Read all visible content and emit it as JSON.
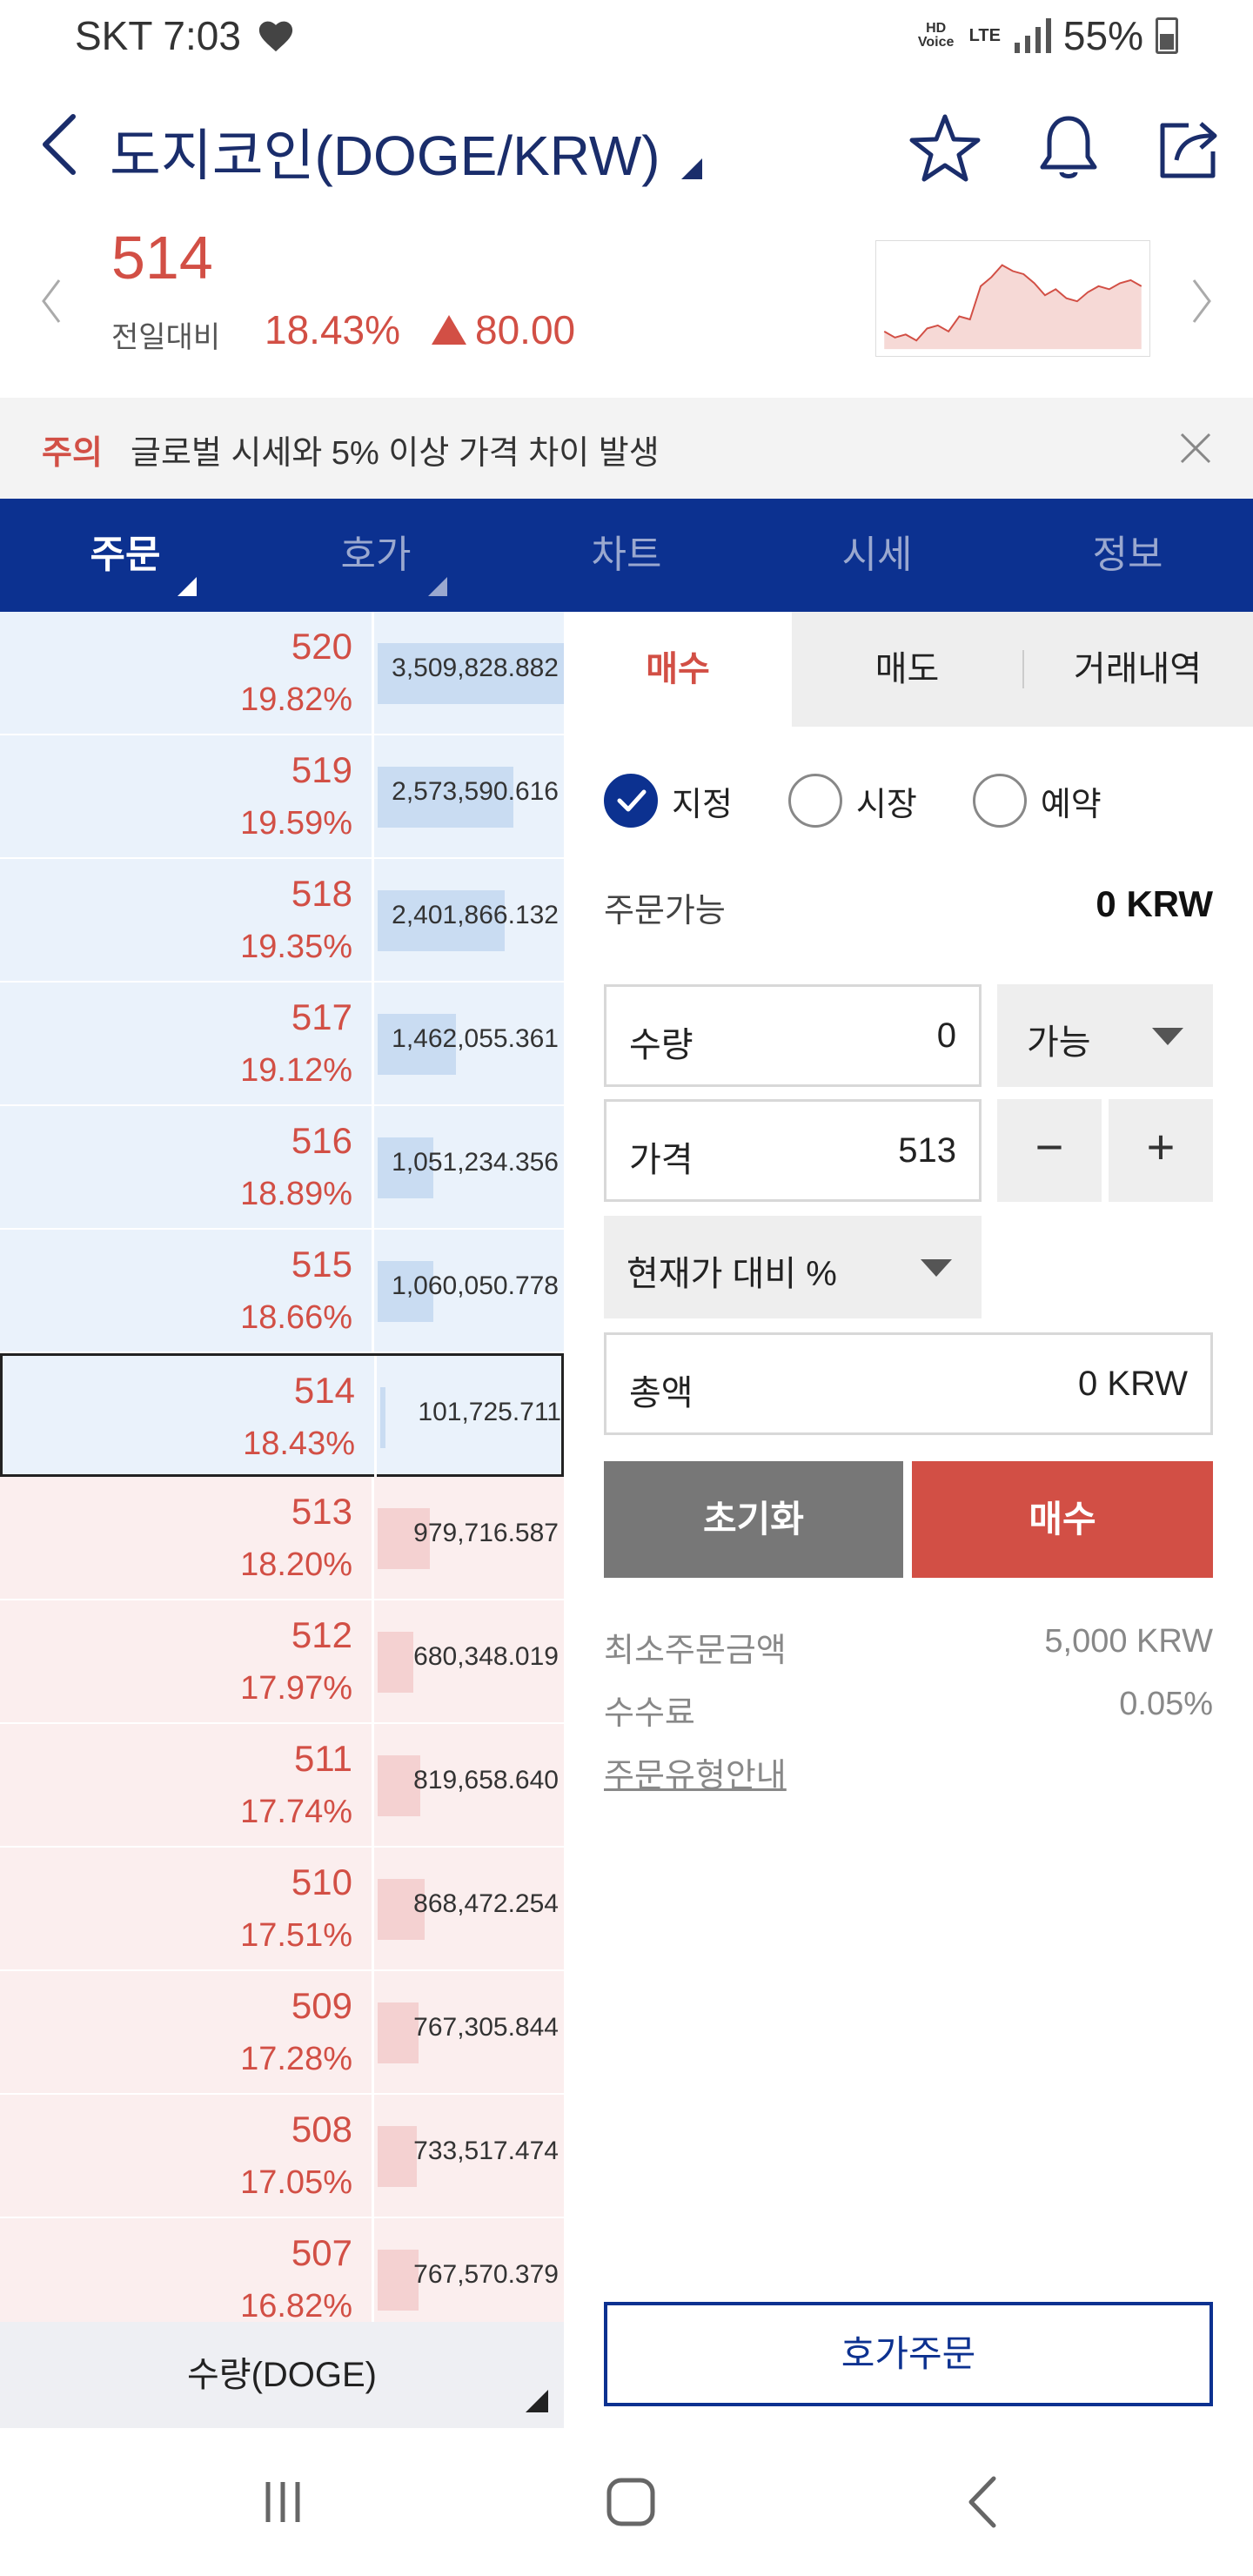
{
  "status_bar": {
    "carrier_time": "SKT 7:03",
    "heart_icon": "heart-icon",
    "hd_voice": "HD Voice",
    "lte": "LTE",
    "battery": "55%"
  },
  "header": {
    "title": "도지코인(DOGE/KRW)",
    "icons": [
      "back-icon",
      "star-icon",
      "bell-icon",
      "share-icon"
    ]
  },
  "price": {
    "current": "514",
    "label": "전일대비",
    "change_pct": "18.43%",
    "change_abs": "80.00",
    "mini_chart": [
      20,
      16,
      18,
      14,
      22,
      24,
      20,
      30,
      28,
      50,
      56,
      64,
      60,
      58,
      52,
      44,
      48,
      42,
      40,
      46,
      50,
      48,
      52,
      54,
      50
    ]
  },
  "notice": {
    "label": "주의",
    "text": "글로벌 시세와 5% 이상 가격 차이 발생"
  },
  "tabs": [
    {
      "label": "주문",
      "active": true,
      "corner": true
    },
    {
      "label": "호가",
      "active": false,
      "corner": true
    },
    {
      "label": "차트",
      "active": false,
      "corner": false
    },
    {
      "label": "시세",
      "active": false,
      "corner": false
    },
    {
      "label": "정보",
      "active": false,
      "corner": false
    }
  ],
  "orderbook": {
    "rows": [
      {
        "price": "520",
        "pct": "19.82%",
        "volume": "3,509,828.882",
        "side": "ask",
        "fill": 1.0
      },
      {
        "price": "519",
        "pct": "19.59%",
        "volume": "2,573,590.616",
        "side": "ask",
        "fill": 0.73
      },
      {
        "price": "518",
        "pct": "19.35%",
        "volume": "2,401,866.132",
        "side": "ask",
        "fill": 0.68
      },
      {
        "price": "517",
        "pct": "19.12%",
        "volume": "1,462,055.361",
        "side": "ask",
        "fill": 0.42
      },
      {
        "price": "516",
        "pct": "18.89%",
        "volume": "1,051,234.356",
        "side": "ask",
        "fill": 0.3
      },
      {
        "price": "515",
        "pct": "18.66%",
        "volume": "1,060,050.778",
        "side": "ask",
        "fill": 0.3
      },
      {
        "price": "514",
        "pct": "18.43%",
        "volume": "101,725.711",
        "side": "ask",
        "fill": 0.03,
        "current": true
      },
      {
        "price": "513",
        "pct": "18.20%",
        "volume": "979,716.587",
        "side": "bid",
        "fill": 0.28
      },
      {
        "price": "512",
        "pct": "17.97%",
        "volume": "680,348.019",
        "side": "bid",
        "fill": 0.19
      },
      {
        "price": "511",
        "pct": "17.74%",
        "volume": "819,658.640",
        "side": "bid",
        "fill": 0.23
      },
      {
        "price": "510",
        "pct": "17.51%",
        "volume": "868,472.254",
        "side": "bid",
        "fill": 0.25
      },
      {
        "price": "509",
        "pct": "17.28%",
        "volume": "767,305.844",
        "side": "bid",
        "fill": 0.22
      },
      {
        "price": "508",
        "pct": "17.05%",
        "volume": "733,517.474",
        "side": "bid",
        "fill": 0.21
      },
      {
        "price": "507",
        "pct": "16.82%",
        "volume": "767,570.379",
        "side": "bid",
        "fill": 0.22
      }
    ],
    "qty_label": "수량(DOGE)"
  },
  "order": {
    "sub_tabs": [
      "매수",
      "매도",
      "거래내역"
    ],
    "radios": [
      {
        "label": "지정",
        "checked": true
      },
      {
        "label": "시장",
        "checked": false
      },
      {
        "label": "예약",
        "checked": false
      }
    ],
    "available_label": "주문가능",
    "available_value": "0 KRW",
    "qty_label": "수량",
    "qty_value": "0",
    "qty_option": "가능",
    "price_label": "가격",
    "price_value": "513",
    "minus": "−",
    "plus": "+",
    "pct_select": "현재가 대비 %",
    "total_label": "총액",
    "total_value": "0 KRW",
    "reset": "초기화",
    "buy": "매수",
    "min_order_label": "최소주문금액",
    "min_order_value": "5,000 KRW",
    "fee_label": "수수료",
    "fee_value": "0.05%",
    "guide": "주문유형안내",
    "hoga_order": "호가주문"
  },
  "colors": {
    "accent_red": "#d24f45",
    "navy": "#0c3190",
    "ask_bg": "#eaf2fb",
    "bid_bg": "#fbeeee"
  }
}
